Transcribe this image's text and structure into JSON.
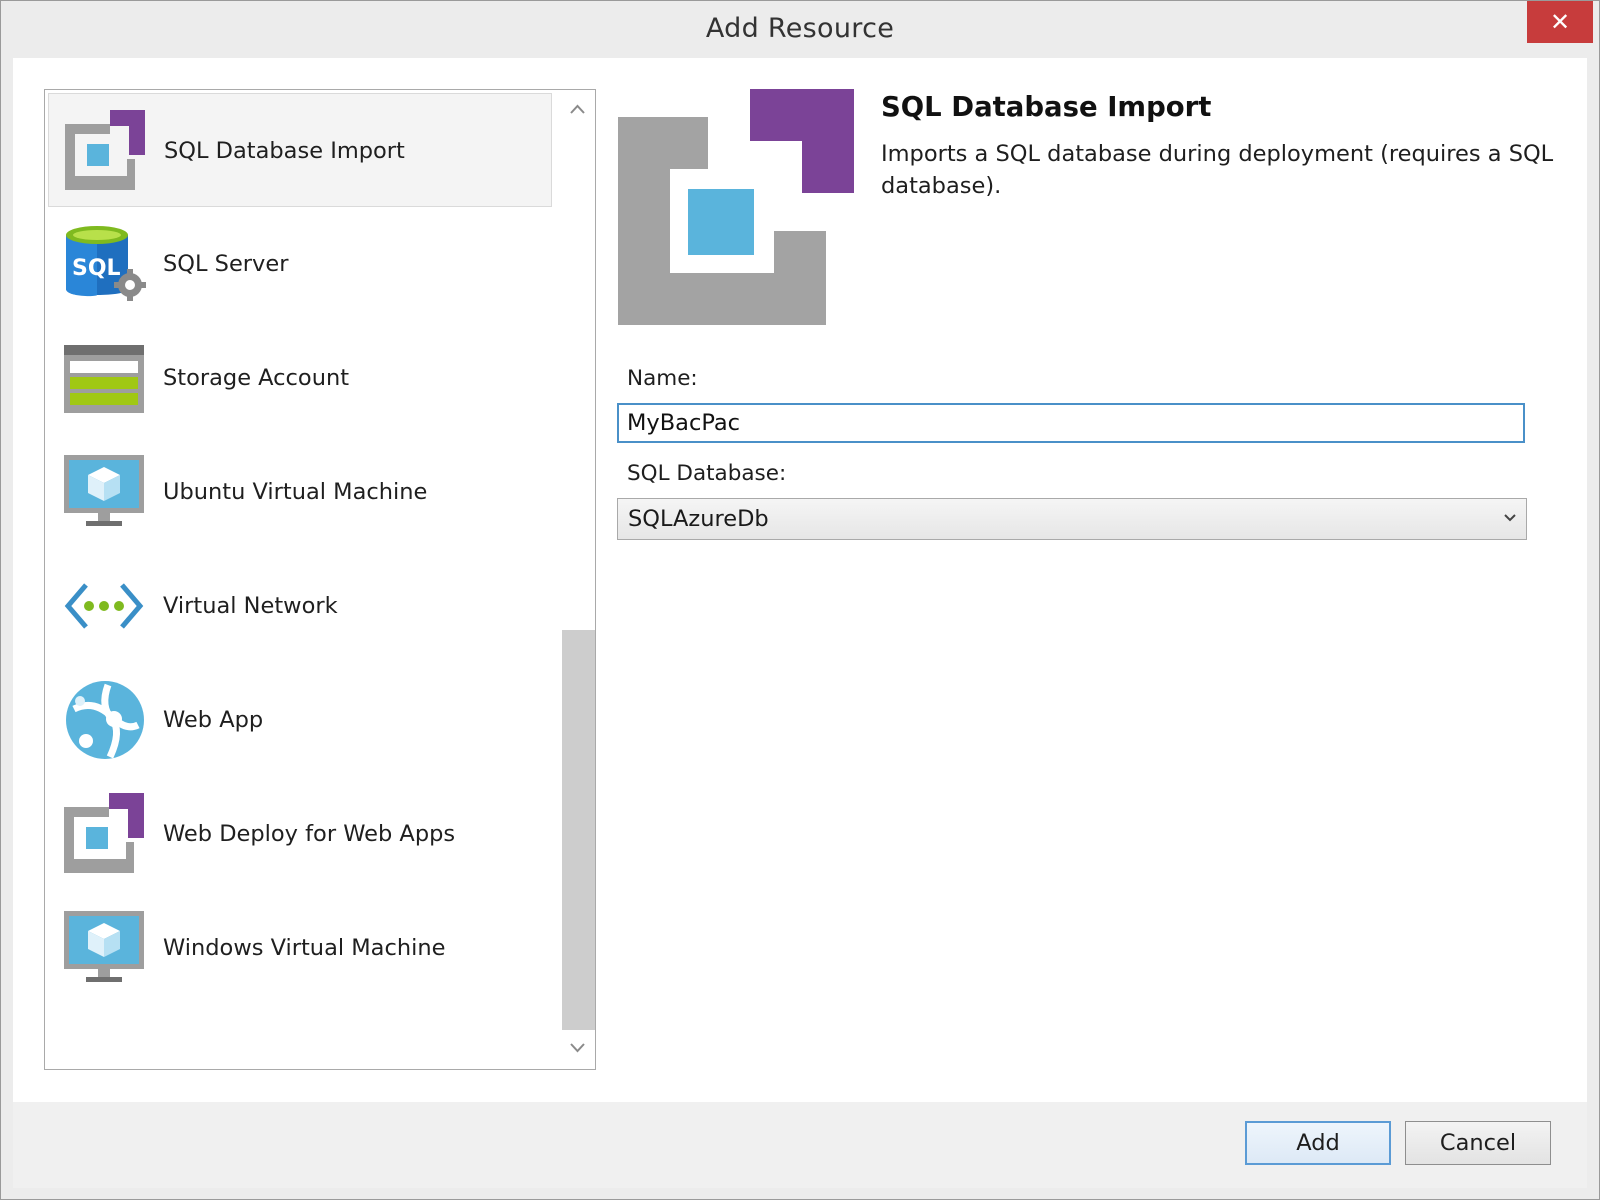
{
  "window": {
    "title": "Add Resource",
    "close_glyph": "✕"
  },
  "resources": [
    {
      "label": "SQL Database Import",
      "icon": "sql-database-import-icon",
      "selected": true
    },
    {
      "label": "SQL Server",
      "icon": "sql-server-icon",
      "badge": "SQL"
    },
    {
      "label": "Storage Account",
      "icon": "storage-account-icon"
    },
    {
      "label": "Ubuntu Virtual Machine",
      "icon": "virtual-machine-icon"
    },
    {
      "label": "Virtual Network",
      "icon": "virtual-network-icon"
    },
    {
      "label": "Web App",
      "icon": "web-app-icon"
    },
    {
      "label": "Web Deploy for Web Apps",
      "icon": "web-deploy-icon"
    },
    {
      "label": "Windows Virtual Machine",
      "icon": "virtual-machine-icon"
    }
  ],
  "detail": {
    "title": "SQL Database Import",
    "description": "Imports a SQL database during deployment (requires a SQL database).",
    "name_label": "Name:",
    "name_value": "MyBacPac",
    "sql_database_label": "SQL Database:",
    "sql_database_value": "SQLAzureDb"
  },
  "buttons": {
    "add": "Add",
    "cancel": "Cancel"
  },
  "colors": {
    "purple": "#7b4397",
    "azure_blue": "#5ab4dc",
    "gray": "#9e9e9e",
    "green": "#a0c814",
    "sql_blue": "#1f6fbf",
    "close_red": "#c73c3c",
    "focus_blue": "#4a90c8"
  }
}
